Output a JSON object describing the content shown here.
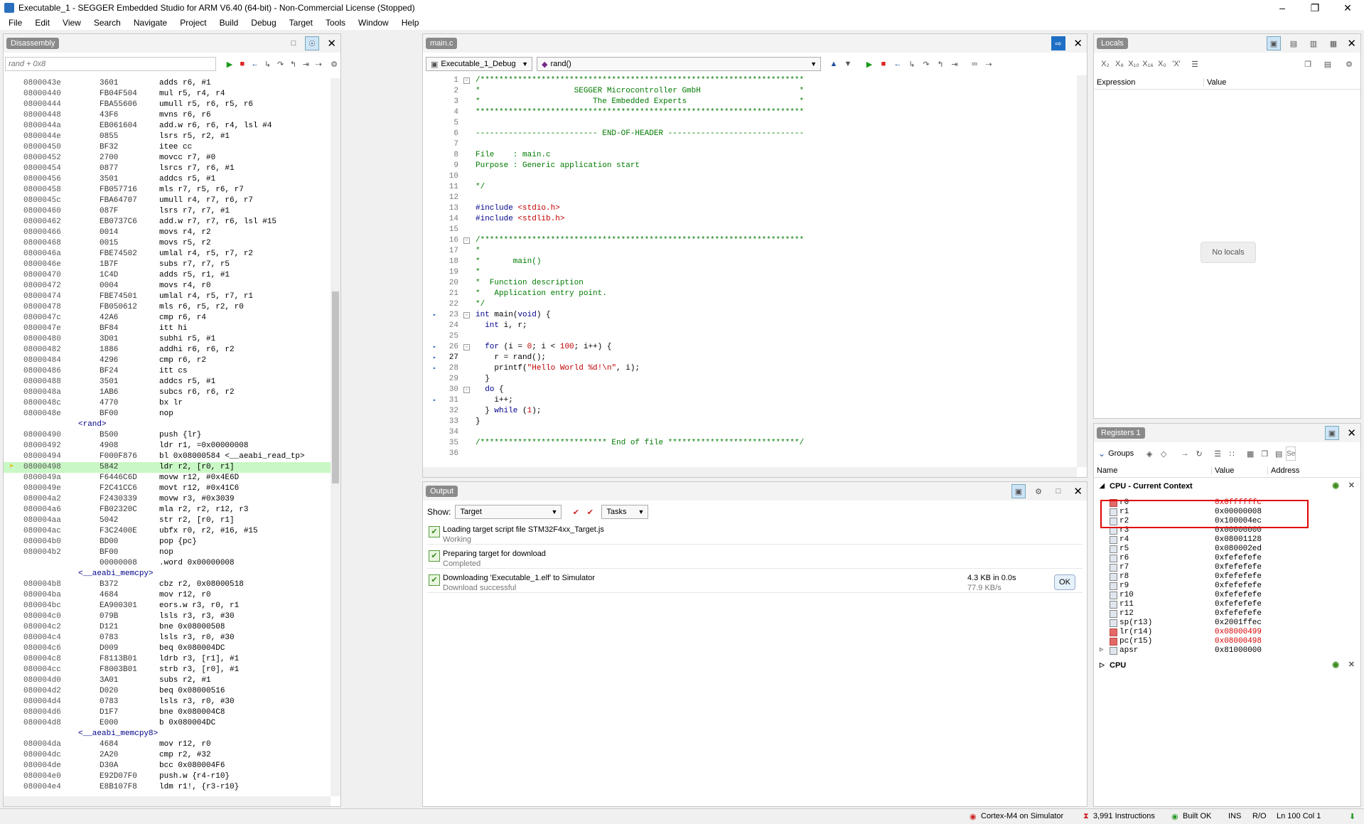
{
  "window": {
    "title": "Executable_1 - SEGGER Embedded Studio for ARM V6.40 (64-bit) - Non-Commercial License (Stopped)"
  },
  "menu": [
    "File",
    "Edit",
    "View",
    "Search",
    "Navigate",
    "Project",
    "Build",
    "Debug",
    "Target",
    "Tools",
    "Window",
    "Help"
  ],
  "disassembly": {
    "tab": "Disassembly",
    "search_placeholder": "rand + 0x8",
    "lines": [
      {
        "a": "0800043e",
        "h": "3601",
        "i": "adds r6, #1"
      },
      {
        "a": "08000440",
        "h": "FB04F504",
        "i": "mul r5, r4, r4"
      },
      {
        "a": "08000444",
        "h": "FBA55606",
        "i": "umull r5, r6, r5, r6"
      },
      {
        "a": "08000448",
        "h": "43F6",
        "i": "mvns r6, r6"
      },
      {
        "a": "0800044a",
        "h": "EB061604",
        "i": "add.w r6, r6, r4, lsl #4"
      },
      {
        "a": "0800044e",
        "h": "0855",
        "i": "lsrs r5, r2, #1"
      },
      {
        "a": "08000450",
        "h": "BF32",
        "i": "itee cc"
      },
      {
        "a": "08000452",
        "h": "2700",
        "i": "movcc r7, #0"
      },
      {
        "a": "08000454",
        "h": "0877",
        "i": "lsrcs r7, r6, #1"
      },
      {
        "a": "08000456",
        "h": "3501",
        "i": "addcs r5, #1"
      },
      {
        "a": "08000458",
        "h": "FB057716",
        "i": "mls r7, r5, r6, r7"
      },
      {
        "a": "0800045c",
        "h": "FBA64707",
        "i": "umull r4, r7, r6, r7"
      },
      {
        "a": "08000460",
        "h": "087F",
        "i": "lsrs r7, r7, #1"
      },
      {
        "a": "08000462",
        "h": "EB0737C6",
        "i": "add.w r7, r7, r6, lsl #15"
      },
      {
        "a": "08000466",
        "h": "0014",
        "i": "movs r4, r2"
      },
      {
        "a": "08000468",
        "h": "0015",
        "i": "movs r5, r2"
      },
      {
        "a": "0800046a",
        "h": "FBE74502",
        "i": "umlal r4, r5, r7, r2"
      },
      {
        "a": "0800046e",
        "h": "1B7F",
        "i": "subs r7, r7, r5"
      },
      {
        "a": "08000470",
        "h": "1C4D",
        "i": "adds r5, r1, #1"
      },
      {
        "a": "08000472",
        "h": "0004",
        "i": "movs r4, r0"
      },
      {
        "a": "08000474",
        "h": "FBE74501",
        "i": "umlal r4, r5, r7, r1"
      },
      {
        "a": "08000478",
        "h": "FB050612",
        "i": "mls r6, r5, r2, r0"
      },
      {
        "a": "0800047c",
        "h": "42A6",
        "i": "cmp r6, r4"
      },
      {
        "a": "0800047e",
        "h": "BF84",
        "i": "itt hi"
      },
      {
        "a": "08000480",
        "h": "3D01",
        "i": "subhi r5, #1"
      },
      {
        "a": "08000482",
        "h": "1886",
        "i": "addhi r6, r6, r2"
      },
      {
        "a": "08000484",
        "h": "4296",
        "i": "cmp r6, r2"
      },
      {
        "a": "08000486",
        "h": "BF24",
        "i": "itt cs"
      },
      {
        "a": "08000488",
        "h": "3501",
        "i": "addcs r5, #1"
      },
      {
        "a": "0800048a",
        "h": "1AB6",
        "i": "subcs r6, r6, r2"
      },
      {
        "a": "0800048c",
        "h": "4770",
        "i": "bx lr"
      },
      {
        "a": "0800048e",
        "h": "BF00",
        "i": "nop"
      },
      {
        "sym": "<rand>"
      },
      {
        "a": "08000490",
        "h": "B500",
        "i": "push {lr}"
      },
      {
        "a": "08000492",
        "h": "4908",
        "i": "ldr r1, =0x00000008"
      },
      {
        "a": "08000494",
        "h": "F000F876",
        "i": "bl 0x08000584 <__aeabi_read_tp>"
      },
      {
        "a": "08000498",
        "h": "5842",
        "i": "ldr r2, [r0, r1]",
        "cur": true
      },
      {
        "a": "0800049a",
        "h": "F6446C6D",
        "i": "movw r12, #0x4E6D"
      },
      {
        "a": "0800049e",
        "h": "F2C41CC6",
        "i": "movt r12, #0x41C6"
      },
      {
        "a": "080004a2",
        "h": "F2430339",
        "i": "movw r3, #0x3039"
      },
      {
        "a": "080004a6",
        "h": "FB02320C",
        "i": "mla r2, r2, r12, r3"
      },
      {
        "a": "080004aa",
        "h": "5042",
        "i": "str r2, [r0, r1]"
      },
      {
        "a": "080004ac",
        "h": "F3C2400E",
        "i": "ubfx r0, r2, #16, #15"
      },
      {
        "a": "080004b0",
        "h": "BD00",
        "i": "pop {pc}"
      },
      {
        "a": "080004b2",
        "h": "BF00",
        "i": "nop"
      },
      {
        "a": "",
        "h": "00000008",
        "i": ".word 0x00000008"
      },
      {
        "sym": "<__aeabi_memcpy>"
      },
      {
        "a": "080004b8",
        "h": "B372",
        "i": "cbz r2, 0x08000518"
      },
      {
        "a": "080004ba",
        "h": "4684",
        "i": "mov r12, r0"
      },
      {
        "a": "080004bc",
        "h": "EA900301",
        "i": "eors.w r3, r0, r1"
      },
      {
        "a": "080004c0",
        "h": "079B",
        "i": "lsls r3, r3, #30"
      },
      {
        "a": "080004c2",
        "h": "D121",
        "i": "bne 0x08000508"
      },
      {
        "a": "080004c4",
        "h": "0783",
        "i": "lsls r3, r0, #30"
      },
      {
        "a": "080004c6",
        "h": "D009",
        "i": "beq 0x080004DC"
      },
      {
        "a": "080004c8",
        "h": "F8113B01",
        "i": "ldrb r3, [r1], #1"
      },
      {
        "a": "080004cc",
        "h": "F8003B01",
        "i": "strb r3, [r0], #1"
      },
      {
        "a": "080004d0",
        "h": "3A01",
        "i": "subs r2, #1"
      },
      {
        "a": "080004d2",
        "h": "D020",
        "i": "beq 0x08000516"
      },
      {
        "a": "080004d4",
        "h": "0783",
        "i": "lsls r3, r0, #30"
      },
      {
        "a": "080004d6",
        "h": "D1F7",
        "i": "bne 0x080004C8"
      },
      {
        "a": "080004d8",
        "h": "E000",
        "i": "b 0x080004DC"
      },
      {
        "sym": "<__aeabi_memcpy8>"
      },
      {
        "a": "080004da",
        "h": "4684",
        "i": "mov r12, r0"
      },
      {
        "a": "080004dc",
        "h": "2A20",
        "i": "cmp r2, #32"
      },
      {
        "a": "080004de",
        "h": "D30A",
        "i": "bcc 0x080004F6"
      },
      {
        "a": "080004e0",
        "h": "E92D07F0",
        "i": "push.w {r4-r10}"
      },
      {
        "a": "080004e4",
        "h": "E8B107F8",
        "i": "ldm r1!, {r3-r10}"
      }
    ]
  },
  "editor": {
    "tab": "main.c",
    "project_combo": "Executable_1_Debug",
    "function_combo": "rand()"
  },
  "output": {
    "tab": "Output",
    "show_label": "Show:",
    "show_value": "Target",
    "tasks": "Tasks",
    "rows": [
      {
        "msg": "Loading target script file STM32F4xx_Target.js",
        "status": "Working"
      },
      {
        "msg": "Preparing target for download",
        "status": "Completed"
      },
      {
        "msg": "Downloading 'Executable_1.elf' to Simulator",
        "status": "Download successful",
        "size": "4.3 KB in 0.0s",
        "rate": "77.9 KB/s",
        "ok": "OK"
      }
    ]
  },
  "locals": {
    "tab": "Locals",
    "col_expression": "Expression",
    "col_value": "Value",
    "empty": "No locals"
  },
  "registers": {
    "tab": "Registers 1",
    "groups": "Groups",
    "search_placeholder": "Se",
    "col_name": "Name",
    "col_value": "Value",
    "col_address": "Address",
    "group_current": "CPU - Current Context",
    "group_cpu": "CPU",
    "rows": [
      {
        "n": "r0",
        "v": "0x0ffffffc",
        "chg": true
      },
      {
        "n": "r1",
        "v": "0x00000008"
      },
      {
        "n": "r2",
        "v": "0x100004ec"
      },
      {
        "n": "r3",
        "v": "0x00000000"
      },
      {
        "n": "r4",
        "v": "0x08001128"
      },
      {
        "n": "r5",
        "v": "0x080002ed"
      },
      {
        "n": "r6",
        "v": "0xfefefefe"
      },
      {
        "n": "r7",
        "v": "0xfefefefe"
      },
      {
        "n": "r8",
        "v": "0xfefefefe"
      },
      {
        "n": "r9",
        "v": "0xfefefefe"
      },
      {
        "n": "r10",
        "v": "0xfefefefe"
      },
      {
        "n": "r11",
        "v": "0xfefefefe"
      },
      {
        "n": "r12",
        "v": "0xfefefefe"
      },
      {
        "n": "sp(r13)",
        "v": "0x2001ffec"
      },
      {
        "n": "lr(r14)",
        "v": "0x08000499",
        "chg": true
      },
      {
        "n": "pc(r15)",
        "v": "0x08000498",
        "chg": true
      },
      {
        "n": "apsr",
        "v": "0x81000000"
      }
    ]
  },
  "status": {
    "target": "Cortex-M4 on Simulator",
    "instructions": "3,991 Instructions",
    "build": "Built OK",
    "ins": "INS",
    "ro": "R/O",
    "pos": "Ln 100 Col 1"
  },
  "icons": [
    "app-icon",
    "run-icon",
    "stop-icon",
    "step-icon",
    "settings-icon",
    "close-icon",
    "check-icon"
  ]
}
